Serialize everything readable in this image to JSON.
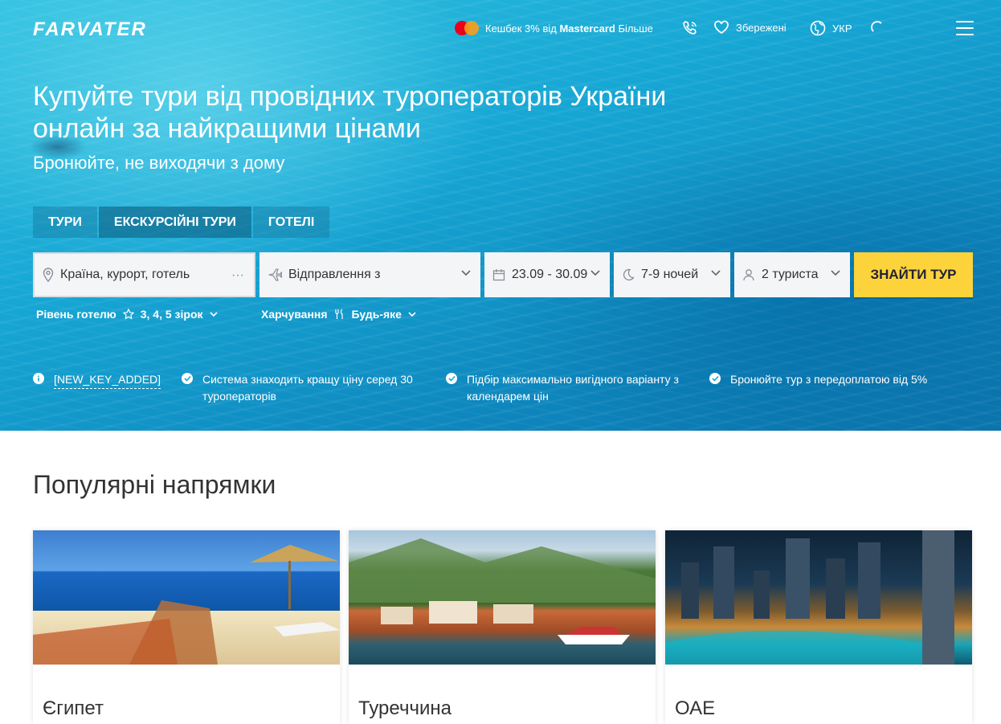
{
  "header": {
    "logo": "FARVATER",
    "promo_prefix": "Кешбек 3% від",
    "promo_brand": "Mastercard",
    "promo_more": "Більше",
    "saved_label": "Збережені",
    "lang_label": "УКР"
  },
  "hero": {
    "title_line1": "Купуйте тури від провідних туроператорів України",
    "title_line2": "онлайн за найкращими цінами",
    "subtitle": "Бронюйте, не виходячи з дому"
  },
  "tabs": [
    {
      "label": "ТУРИ"
    },
    {
      "label": "ЕКСКУРСІЙНІ ТУРИ"
    },
    {
      "label": "ГОТЕЛІ"
    }
  ],
  "search": {
    "country_placeholder": "Країна, курорт, готель",
    "departure_placeholder": "Відправлення з",
    "dates_value": "23.09 - 30.09",
    "nights_value": "7-9 ночей",
    "tourists_value": "2 туриста",
    "find_button": "ЗНАЙТИ ТУР"
  },
  "options": {
    "hotel_level_label": "Рівень готелю",
    "hotel_level_value": "3, 4, 5 зірок",
    "meals_label": "Харчування",
    "meals_value": "Будь-яке"
  },
  "features": [
    "[NEW_KEY_ADDED]",
    "Система знаходить кращу ціну серед 30 туроператорів",
    "Підбір максимально вигідного варіанту з календарем цін",
    "Бронюйте тур з передоплатою від 5%"
  ],
  "popular": {
    "title": "Популярні напрямки",
    "destinations": [
      {
        "name": "Єгипет"
      },
      {
        "name": "Туреччина"
      },
      {
        "name": "ОАЕ"
      }
    ]
  },
  "colors": {
    "accent_button": "#fcd33b",
    "hero_sea": "#16a6d4"
  }
}
